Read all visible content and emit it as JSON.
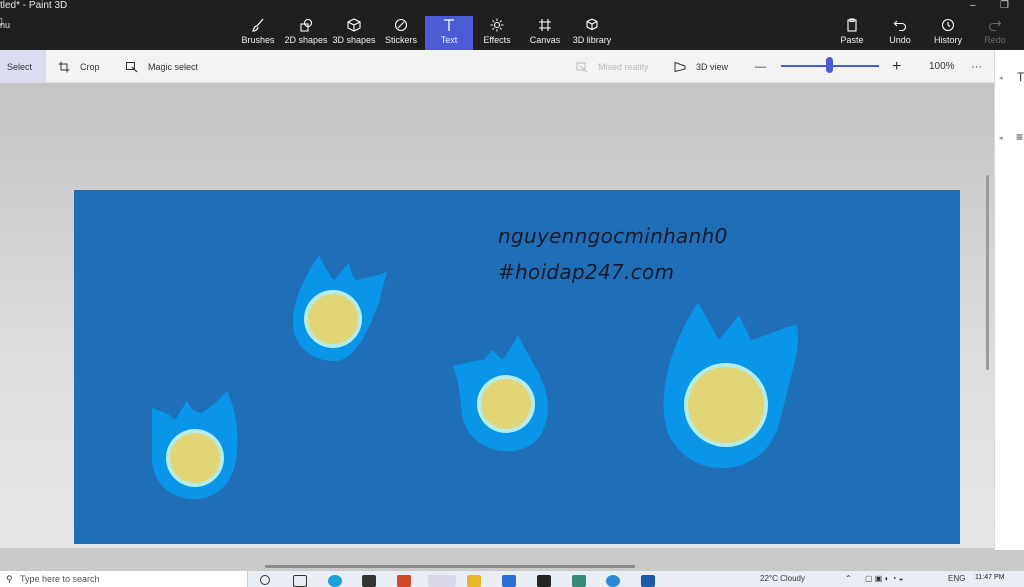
{
  "window": {
    "title": "tled* - Paint 3D",
    "menu_label": "nu",
    "controls": [
      "–",
      "❐"
    ]
  },
  "toolbar": {
    "tools": [
      {
        "id": "brushes",
        "label": "Brushes",
        "icon": "brush-icon"
      },
      {
        "id": "2d-shapes",
        "label": "2D shapes",
        "icon": "2d-shapes-icon"
      },
      {
        "id": "3d-shapes",
        "label": "3D shapes",
        "icon": "3d-shapes-icon"
      },
      {
        "id": "stickers",
        "label": "Stickers",
        "icon": "sticker-icon"
      },
      {
        "id": "text",
        "label": "Text",
        "icon": "text-icon",
        "active": true
      },
      {
        "id": "effects",
        "label": "Effects",
        "icon": "effects-icon"
      },
      {
        "id": "canvas",
        "label": "Canvas",
        "icon": "canvas-icon"
      },
      {
        "id": "3d-library",
        "label": "3D library",
        "icon": "3d-library-icon"
      }
    ],
    "right_tools": [
      {
        "id": "paste",
        "label": "Paste",
        "icon": "paste-icon"
      },
      {
        "id": "undo",
        "label": "Undo",
        "icon": "undo-icon"
      },
      {
        "id": "history",
        "label": "History",
        "icon": "history-icon"
      },
      {
        "id": "redo",
        "label": "Redo",
        "icon": "redo-icon",
        "disabled": true
      }
    ],
    "active_color": "#4c5bd4"
  },
  "subtoolbar": {
    "select": "Select",
    "crop": "Crop",
    "magic_select": "Magic select",
    "mixed_reality": "Mixed reality",
    "view_3d": "3D view",
    "zoom_minus": "—",
    "zoom_plus": "+",
    "zoom_percent": "100%",
    "zoom_level": 0.5,
    "more": "···"
  },
  "canvas": {
    "background_color": "#1e6eb8",
    "text_line1": "nguyenngocminhanh0",
    "text_line2": "#hoidap247.com",
    "flame_outer_color": "#0a96e8",
    "flame_inner_color": "#b4ecea",
    "flame_core_color": "#e1d576"
  },
  "taskbar": {
    "search_placeholder": "Type here to search",
    "weather": "22°C  Cloudy",
    "language": "ENG",
    "time": "11:47 PM",
    "apps": [
      "task-view",
      "edge",
      "store",
      "office",
      "paint3d",
      "explorer",
      "mail",
      "terminal",
      "calculator",
      "zalo",
      "mail2"
    ]
  }
}
